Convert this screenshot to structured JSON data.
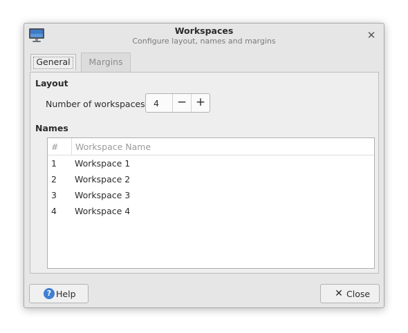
{
  "window": {
    "title": "Workspaces",
    "subtitle": "Configure layout, names and margins"
  },
  "icons": {
    "app": "monitor-icon",
    "close": "close-icon",
    "help": "help-icon",
    "close_button": "close-x-icon"
  },
  "tabs": [
    {
      "label": "General",
      "active": true
    },
    {
      "label": "Margins",
      "active": false
    }
  ],
  "general": {
    "layout_heading": "Layout",
    "num_workspaces_label": "Number of workspaces:",
    "num_workspaces_value": "4",
    "minus_label": "−",
    "plus_label": "+",
    "names_heading": "Names",
    "table": {
      "columns": [
        "#",
        "Workspace Name"
      ],
      "rows": [
        {
          "num": "1",
          "name": "Workspace 1"
        },
        {
          "num": "2",
          "name": "Workspace 2"
        },
        {
          "num": "3",
          "name": "Workspace 3"
        },
        {
          "num": "4",
          "name": "Workspace 4"
        }
      ]
    }
  },
  "buttons": {
    "help_label": "Help",
    "close_label": "Close"
  },
  "colors": {
    "help_icon": "#3f7fd4",
    "window_bg": "#e6e6e6",
    "panel_bg": "#eeeeee"
  }
}
